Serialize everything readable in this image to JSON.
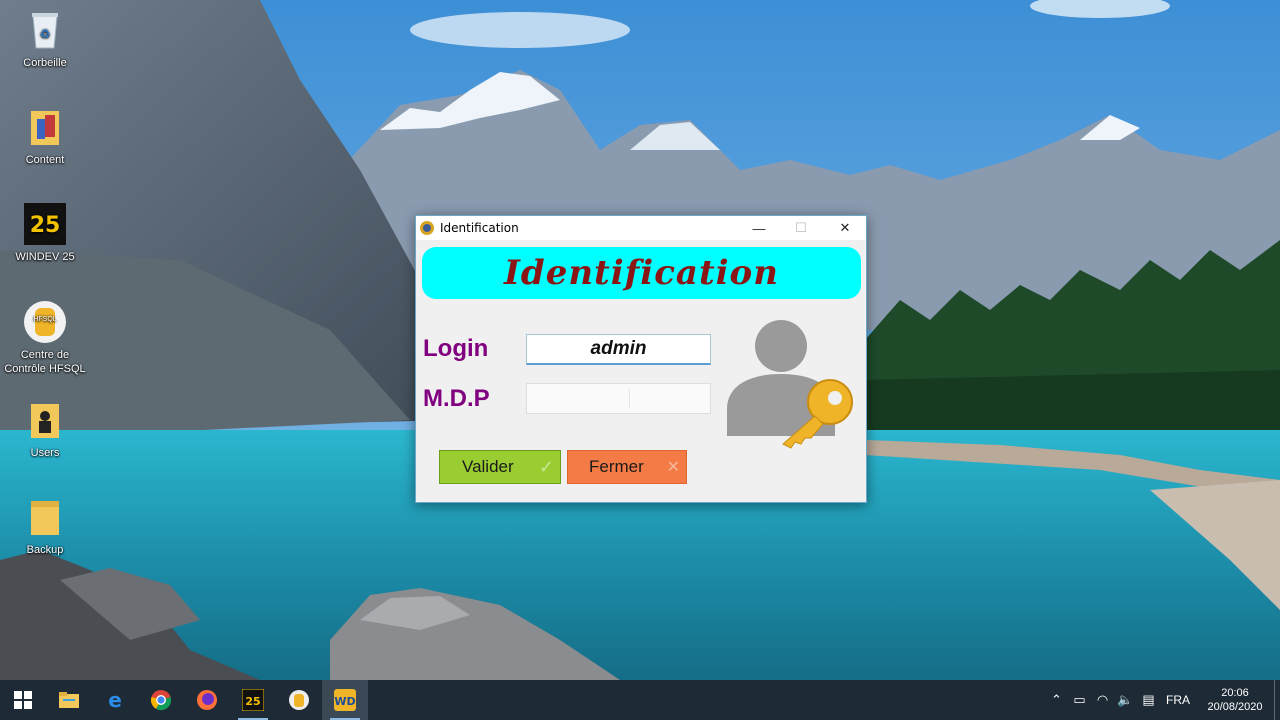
{
  "desktop": {
    "icons": [
      {
        "label": "Corbeille",
        "icon": "recycle-bin-icon"
      },
      {
        "label": "Content",
        "icon": "folder-icon"
      },
      {
        "label": "WINDEV 25",
        "icon": "windev-icon"
      },
      {
        "label": "Centre de Contrôle HFSQL",
        "icon": "hfsql-icon"
      },
      {
        "label": "Users",
        "icon": "folder-icon"
      },
      {
        "label": "Backup",
        "icon": "folder-icon"
      }
    ]
  },
  "window": {
    "title": "Identification",
    "controls": {
      "minimize": "—",
      "maximize": "☐",
      "close": "✕"
    },
    "banner_text": "Identification",
    "login_label": "Login",
    "login_value": "admin",
    "password_label": "M.D.P",
    "password_value": "",
    "validate_label": "Valider",
    "validate_mark": "✓",
    "close_label": "Fermer",
    "close_mark": "✕"
  },
  "colors": {
    "banner": "#00ffff",
    "banner_text": "#8b1515",
    "labels": "#800080",
    "validate_button": "#9acd32",
    "close_button": "#f57b46",
    "taskbar": "#1e2a35"
  },
  "taskbar": {
    "items": [
      "start-icon",
      "file-explorer-icon",
      "edge-icon",
      "chrome-icon",
      "firefox-icon",
      "windev-icon",
      "hfsql-icon",
      "windev-app-icon"
    ],
    "tray": {
      "language": "FRA",
      "time": "20:06",
      "date": "20/08/2020"
    }
  }
}
